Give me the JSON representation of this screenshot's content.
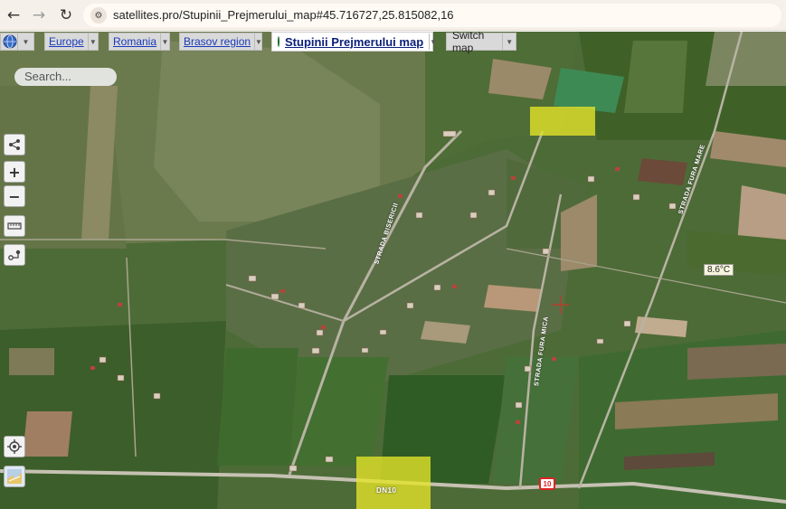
{
  "browser": {
    "url": "satellites.pro/Stupinii_Prejmerului_map#45.716727,25.815082,16"
  },
  "toolbar": {
    "europe": "Europe",
    "country": "Romania",
    "region": "Brasov region",
    "place": "Stupinii Prejmerului map",
    "switch": "Switch map"
  },
  "search": {
    "placeholder": "Search..."
  },
  "map_labels": {
    "strada_bisericii": "STRADA BISERICII",
    "strada_fura_mica": "STRADA FURA MICA",
    "strada_fura_mare": "STRADA FURA MARE",
    "road_dn10": "DN10",
    "road_shield": "10",
    "temperature": "8.6°C"
  },
  "icons": [
    "back-icon",
    "forward-icon",
    "reload-icon",
    "site-settings-icon",
    "globe-icon",
    "share-icon",
    "zoom-in-icon",
    "zoom-out-icon",
    "ruler-icon",
    "route-icon",
    "locate-icon",
    "layer-thumbnail-icon"
  ]
}
